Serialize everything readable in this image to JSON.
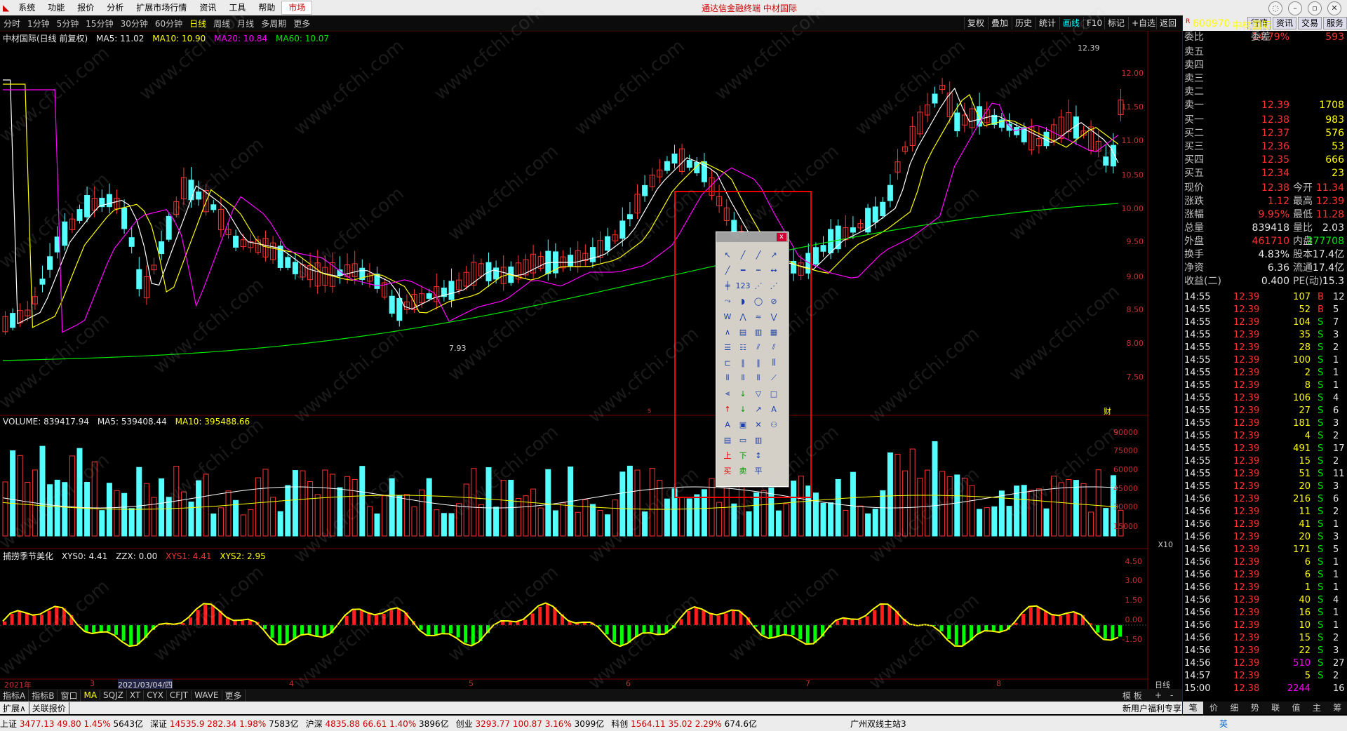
{
  "menubar": {
    "items": [
      "系统",
      "功能",
      "报价",
      "分析",
      "扩展市场行情",
      "资讯",
      "工具",
      "帮助"
    ],
    "market": "市场",
    "title": "通达信金融终端 中材国际"
  },
  "toolbar": {
    "periods": [
      "分时",
      "1分钟",
      "5分钟",
      "15分钟",
      "30分钟",
      "60分钟",
      "日线",
      "周线",
      "月线",
      "多周期",
      "更多"
    ],
    "active_period": "日线",
    "right_buttons": [
      "复权",
      "叠加",
      "历史",
      "统计",
      "画线",
      "F10",
      "标记",
      "+自选",
      "返回"
    ],
    "active_right": "画线"
  },
  "main_chart": {
    "name": "中材国际(日线 前复权)",
    "ma": [
      {
        "label": "MA5: 11.02",
        "color": "#ffffff"
      },
      {
        "label": "MA10: 10.90",
        "color": "#ffff00"
      },
      {
        "label": "MA20: 10.84",
        "color": "#ff00ff"
      },
      {
        "label": "MA60: 10.07",
        "color": "#00e600"
      }
    ],
    "y_ticks": [
      "12.00",
      "11.50",
      "11.00",
      "10.50",
      "10.00",
      "9.50",
      "9.00",
      "8.50",
      "8.00",
      "7.50"
    ],
    "high_label": "12.39",
    "low_label": "7.93",
    "marker_cai": "财",
    "marker_s": "s"
  },
  "volume_chart": {
    "name": "VOLUME: 839417.94",
    "ma5": "MA5: 539408.44",
    "ma10": "MA10: 395488.66",
    "y_ticks": [
      "90000",
      "75000",
      "60000",
      "45000",
      "30000",
      "15000"
    ],
    "unit": "X10"
  },
  "indicator_chart": {
    "name": "捕捞季节美化",
    "xys0": "XYS0: 4.41",
    "zzx": "ZZX: 0.00",
    "xys1": "XYS1: 4.41",
    "xys2": "XYS2: 2.95",
    "y_ticks": [
      "4.50",
      "3.00",
      "1.50",
      "0.00",
      "-1.50"
    ]
  },
  "date_axis": {
    "labels": [
      "2021年",
      "3",
      "2021/03/04/四",
      "4",
      "5",
      "6",
      "7",
      "8"
    ],
    "period": "日线"
  },
  "bottom_tabs": {
    "row1": [
      "指标A",
      "指标B",
      "窗口",
      "MA",
      "SQJZ",
      "XT",
      "CYX",
      "CFJT",
      "WAVE",
      "更多"
    ],
    "row1_right": [
      "模",
      "板",
      "+",
      "-"
    ],
    "row2": [
      "扩展∧",
      "关联报价"
    ],
    "row2_right": "新用户福利专享"
  },
  "quote": {
    "code": "600970",
    "name": "中材国际",
    "weibi_label": "委比",
    "weibi": "14.79%",
    "weicha_label": "委差",
    "weicha": "593",
    "sell": [
      {
        "l": "卖五",
        "p": "",
        "v": ""
      },
      {
        "l": "卖四",
        "p": "",
        "v": ""
      },
      {
        "l": "卖三",
        "p": "",
        "v": ""
      },
      {
        "l": "卖二",
        "p": "",
        "v": ""
      },
      {
        "l": "卖一",
        "p": "12.39",
        "v": "1708"
      }
    ],
    "buy": [
      {
        "l": "买一",
        "p": "12.38",
        "v": "983"
      },
      {
        "l": "买二",
        "p": "12.37",
        "v": "576"
      },
      {
        "l": "买三",
        "p": "12.36",
        "v": "53"
      },
      {
        "l": "买四",
        "p": "12.35",
        "v": "666"
      },
      {
        "l": "买五",
        "p": "12.34",
        "v": "23"
      }
    ],
    "stats": [
      {
        "l": "现价",
        "p": "12.38",
        "l2": "今开",
        "v": "11.34"
      },
      {
        "l": "涨跌",
        "p": "1.12",
        "l2": "最高",
        "v": "12.39"
      },
      {
        "l": "涨幅",
        "p": "9.95%",
        "l2": "最低",
        "v": "11.28"
      },
      {
        "l": "总量",
        "p": "839418",
        "l2": "量比",
        "v": "2.03"
      },
      {
        "l": "外盘",
        "p": "461710",
        "l2": "内盘",
        "v": "377708"
      },
      {
        "l": "换手",
        "p": "4.83%",
        "l2": "股本",
        "v": "17.4亿"
      },
      {
        "l": "净资",
        "p": "6.36",
        "l2": "流通",
        "v": "17.4亿"
      },
      {
        "l": "收益(二)",
        "p": "0.400",
        "l2": "PE(动)",
        "v": "15.3"
      }
    ],
    "ticks": [
      {
        "t": "14:55",
        "p": "12.39",
        "v": "107",
        "s": "B",
        "n": "12"
      },
      {
        "t": "14:55",
        "p": "12.39",
        "v": "52",
        "s": "B",
        "n": "5"
      },
      {
        "t": "14:55",
        "p": "12.39",
        "v": "104",
        "s": "S",
        "n": "7"
      },
      {
        "t": "14:55",
        "p": "12.39",
        "v": "35",
        "s": "S",
        "n": "3"
      },
      {
        "t": "14:55",
        "p": "12.39",
        "v": "28",
        "s": "S",
        "n": "2"
      },
      {
        "t": "14:55",
        "p": "12.39",
        "v": "100",
        "s": "S",
        "n": "1"
      },
      {
        "t": "14:55",
        "p": "12.39",
        "v": "2",
        "s": "S",
        "n": "1"
      },
      {
        "t": "14:55",
        "p": "12.39",
        "v": "8",
        "s": "S",
        "n": "1"
      },
      {
        "t": "14:55",
        "p": "12.39",
        "v": "106",
        "s": "S",
        "n": "4"
      },
      {
        "t": "14:55",
        "p": "12.39",
        "v": "27",
        "s": "S",
        "n": "6"
      },
      {
        "t": "14:55",
        "p": "12.39",
        "v": "181",
        "s": "S",
        "n": "3"
      },
      {
        "t": "14:55",
        "p": "12.39",
        "v": "4",
        "s": "S",
        "n": "2"
      },
      {
        "t": "14:55",
        "p": "12.39",
        "v": "491",
        "s": "S",
        "n": "17"
      },
      {
        "t": "14:55",
        "p": "12.39",
        "v": "15",
        "s": "S",
        "n": "2"
      },
      {
        "t": "14:55",
        "p": "12.39",
        "v": "51",
        "s": "S",
        "n": "11"
      },
      {
        "t": "14:55",
        "p": "12.39",
        "v": "20",
        "s": "S",
        "n": "3"
      },
      {
        "t": "14:56",
        "p": "12.39",
        "v": "216",
        "s": "S",
        "n": "6"
      },
      {
        "t": "14:56",
        "p": "12.39",
        "v": "11",
        "s": "S",
        "n": "2"
      },
      {
        "t": "14:56",
        "p": "12.39",
        "v": "41",
        "s": "S",
        "n": "1"
      },
      {
        "t": "14:56",
        "p": "12.39",
        "v": "20",
        "s": "S",
        "n": "3"
      },
      {
        "t": "14:56",
        "p": "12.39",
        "v": "171",
        "s": "S",
        "n": "5"
      },
      {
        "t": "14:56",
        "p": "12.39",
        "v": "6",
        "s": "S",
        "n": "1"
      },
      {
        "t": "14:56",
        "p": "12.39",
        "v": "6",
        "s": "S",
        "n": "1"
      },
      {
        "t": "14:56",
        "p": "12.39",
        "v": "1",
        "s": "S",
        "n": "1"
      },
      {
        "t": "14:56",
        "p": "12.39",
        "v": "40",
        "s": "S",
        "n": "4"
      },
      {
        "t": "14:56",
        "p": "12.39",
        "v": "16",
        "s": "S",
        "n": "1"
      },
      {
        "t": "14:56",
        "p": "12.39",
        "v": "10",
        "s": "S",
        "n": "1"
      },
      {
        "t": "14:56",
        "p": "12.39",
        "v": "15",
        "s": "S",
        "n": "2"
      },
      {
        "t": "14:56",
        "p": "12.39",
        "v": "22",
        "s": "S",
        "n": "3"
      },
      {
        "t": "14:56",
        "p": "12.39",
        "v": "510",
        "s": "S",
        "n": "27"
      },
      {
        "t": "14:57",
        "p": "12.39",
        "v": "5",
        "s": "S",
        "n": "2"
      },
      {
        "t": "15:00",
        "p": "12.38",
        "v": "2244",
        "s": "",
        "n": "16"
      }
    ],
    "bottom_tabs": [
      "笔",
      "价",
      "细",
      "势",
      "联",
      "值",
      "主",
      "筹"
    ]
  },
  "statusbar": {
    "items": [
      {
        "name": "上证",
        "price": "3477.13",
        "chg": "49.80",
        "pct": "1.45%",
        "amt": "5643亿"
      },
      {
        "name": "深证",
        "price": "14535.9",
        "chg": "282.34",
        "pct": "1.98%",
        "amt": "7583亿"
      },
      {
        "name": "沪深",
        "price": "4835.88",
        "chg": "66.61",
        "pct": "1.40%",
        "amt": "3896亿"
      },
      {
        "name": "创业",
        "price": "3293.77",
        "chg": "100.87",
        "pct": "3.16%",
        "amt": "3099亿"
      },
      {
        "name": "科创",
        "price": "1564.11",
        "chg": "35.02",
        "pct": "2.29%",
        "amt": "674.6亿"
      }
    ],
    "server": "广州双线主站3",
    "ime": "英"
  },
  "watermark": "www.cfchi.com"
}
